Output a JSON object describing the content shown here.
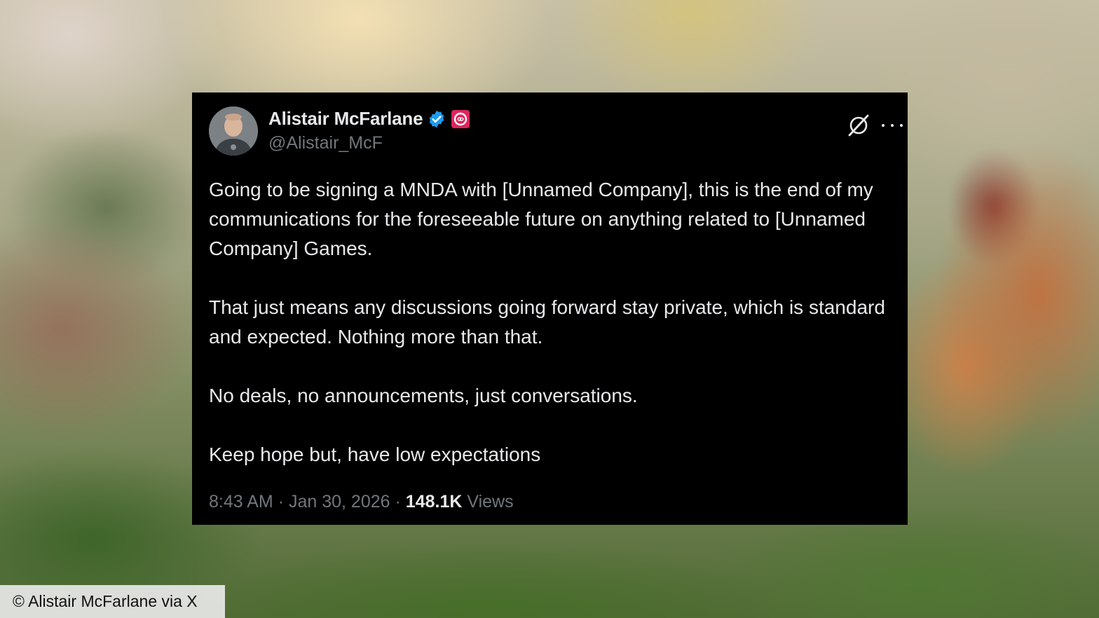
{
  "tweet": {
    "display_name": "Alistair McFarlane",
    "handle": "@Alistair_McF",
    "paragraphs": [
      "Going to be signing a MNDA with [Unnamed Company], this is the end of my communications for the foreseeable future on anything related to [Unnamed Company] Games.",
      "That just means any discussions going forward stay private, which is standard and expected. Nothing more than that.",
      "No deals, no announcements, just conversations.",
      "Keep hope but, have low expectations"
    ],
    "time": "8:43 AM",
    "separator": "·",
    "date": "Jan 30, 2026",
    "views_count": "148.1K",
    "views_label": "Views",
    "icons": {
      "verified": "verified-badge-icon",
      "affiliate": "affiliate-badge-icon",
      "grok": "grok-icon",
      "more": "more-options-icon"
    },
    "colors": {
      "background": "#000000",
      "text": "#e7e9ea",
      "secondary": "#71767b",
      "verified": "#1d9bf0",
      "affiliate": "#e0245e"
    }
  },
  "credit": {
    "text": "© Alistair McFarlane via X"
  }
}
